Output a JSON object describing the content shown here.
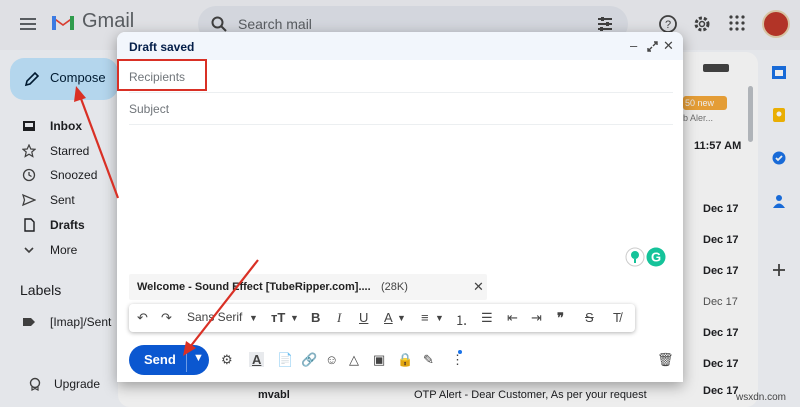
{
  "header": {
    "logo_text": "Gmail",
    "search_placeholder": "Search mail"
  },
  "sidebar": {
    "compose_label": "Compose",
    "items": [
      {
        "label": "Inbox",
        "icon": "inbox-icon"
      },
      {
        "label": "Starred",
        "icon": "star-icon"
      },
      {
        "label": "Snoozed",
        "icon": "clock-icon"
      },
      {
        "label": "Sent",
        "icon": "send-icon"
      },
      {
        "label": "Drafts",
        "icon": "draft-icon"
      },
      {
        "label": "More",
        "icon": "chevron-down-icon"
      }
    ],
    "labels_heading": "Labels",
    "labels": [
      {
        "label": "[Imap]/Sent"
      }
    ],
    "upgrade_label": "Upgrade"
  },
  "list": {
    "badge": "50 new",
    "snippet_top": "b Aler...",
    "time_top": "11:57 AM",
    "dates": [
      "Dec 17",
      "Dec 17",
      "Dec 17",
      "Dec 17",
      "Dec 17",
      "Dec 17",
      "Dec 17",
      "Dec 17"
    ],
    "bottom_sender": "mvabl",
    "bottom_snippet": "OTP Alert - Dear Customer, As per your request"
  },
  "compose_window": {
    "title": "Draft saved",
    "recipients_placeholder": "Recipients",
    "subject_placeholder": "Subject",
    "attachment": {
      "name": "Welcome - Sound Effect [TubeRipper.com]....",
      "size": "(28K)"
    },
    "format_bar": {
      "font": "Sans Serif"
    },
    "send_label": "Send"
  },
  "watermark": "wsxdn.com",
  "colors": {
    "compose_bg": "#c2e7ff",
    "send_bg": "#0b57d0",
    "highlight": "#d93025",
    "arrow": "#d93025"
  }
}
